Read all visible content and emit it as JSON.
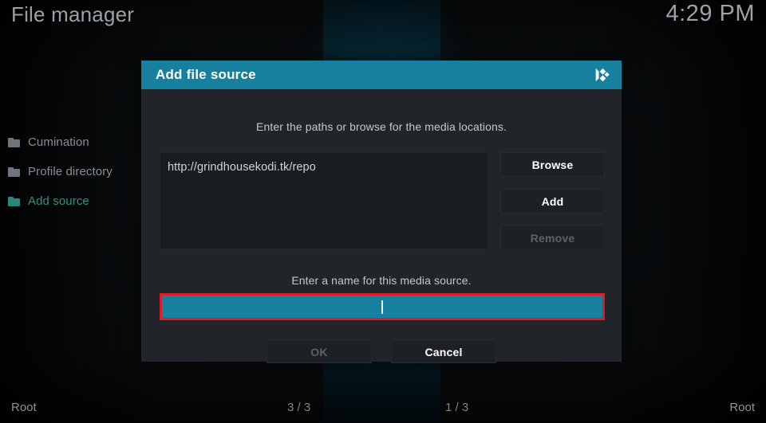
{
  "window": {
    "title": "File manager",
    "clock": "4:29 PM"
  },
  "sidebar": {
    "items": [
      {
        "label": "Cumination",
        "icon": "folder-icon",
        "selected": false
      },
      {
        "label": "Profile directory",
        "icon": "folder-icon",
        "selected": false
      },
      {
        "label": "Add source",
        "icon": "folder-icon",
        "selected": true
      }
    ]
  },
  "dialog": {
    "title": "Add file source",
    "logo_icon": "kodi-logo-icon",
    "paths_hint": "Enter the paths or browse for the media locations.",
    "path_list": [
      "http://grindhousekodi.tk/repo"
    ],
    "buttons": {
      "browse": "Browse",
      "add": "Add",
      "remove": "Remove"
    },
    "name_hint": "Enter a name for this media source.",
    "name_value": "",
    "footer": {
      "ok": "OK",
      "cancel": "Cancel"
    }
  },
  "statusbar": {
    "left": "Root",
    "center_left": "3 / 3",
    "center_right": "1 / 3",
    "right": "Root"
  },
  "colors": {
    "accent": "#17809e",
    "highlight_border": "#e01b28",
    "selected_text": "#35907f",
    "dialog_bg": "#212529"
  }
}
